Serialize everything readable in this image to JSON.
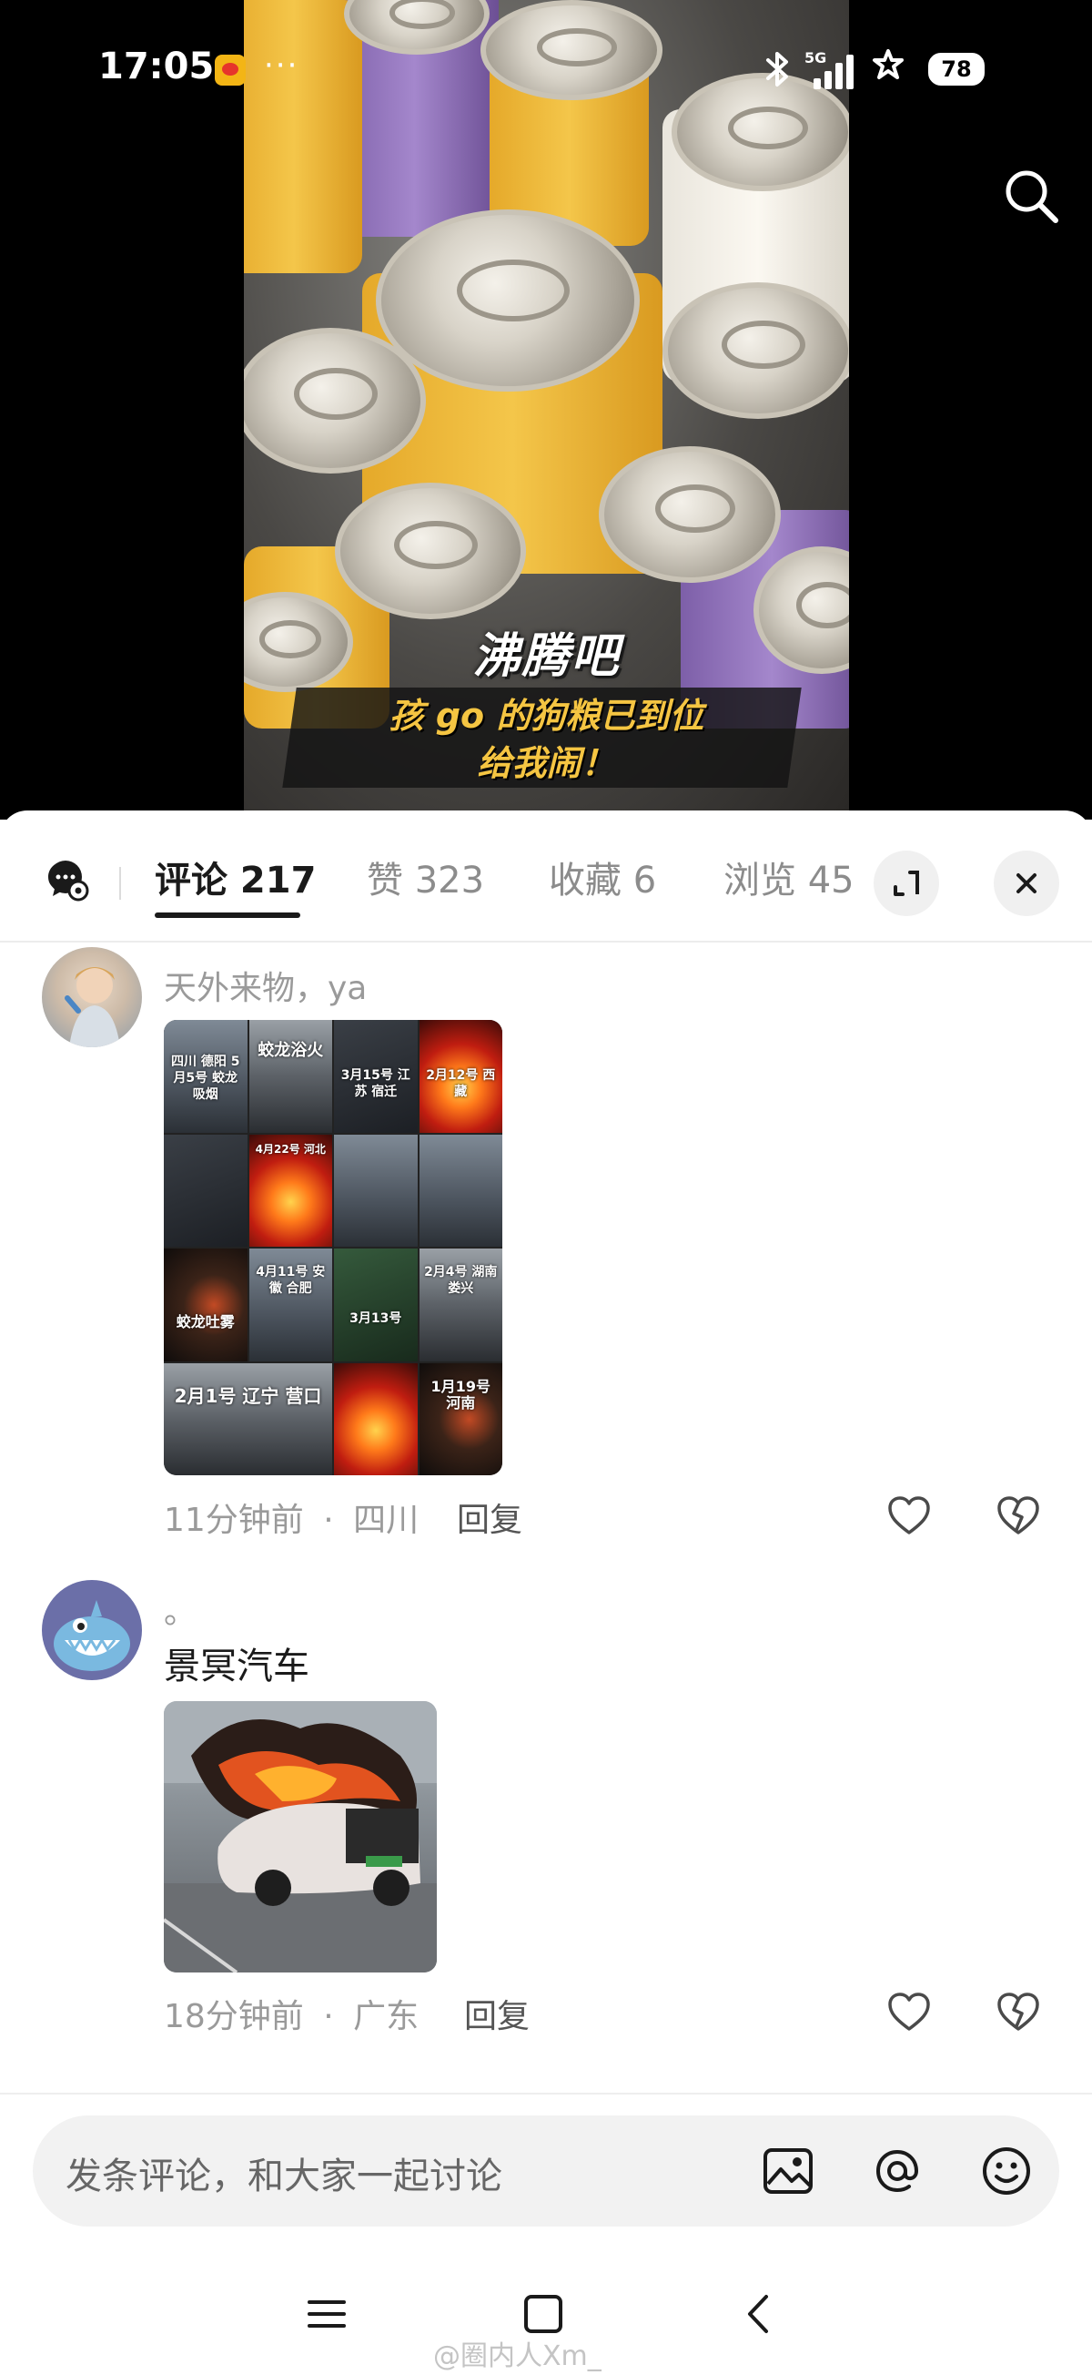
{
  "status_bar": {
    "time": "17:05",
    "dots": "···",
    "network": "5G",
    "battery": "78",
    "icons": [
      "weibo-notification-icon",
      "bluetooth-icon",
      "signal-icon",
      "star-icon",
      "battery-icon"
    ]
  },
  "video": {
    "caption_top": "沸腾吧",
    "caption_line1": "孩 go 的狗粮已到位",
    "caption_line2": "给我闹！"
  },
  "tabs": [
    {
      "label": "评论 217",
      "active": true
    },
    {
      "label": "赞 323",
      "active": false
    },
    {
      "label": "收藏 6",
      "active": false
    },
    {
      "label": "浏览 45",
      "active": false
    }
  ],
  "comments": [
    {
      "name": "天外来物，ya",
      "time": "11分钟前",
      "sep": "·",
      "location": "四川",
      "reply": "回复",
      "collage_labels": [
        "四川 德阳 5月5号 蛟龙吸烟",
        "蛟龙浴火",
        "4月22号 河北",
        "3月15号 江苏 宿迁",
        "2月12号 西藏",
        "蛟龙吐雾",
        "4月11号 安徽 合肥",
        "3月13号",
        "2月4号 湖南娄兴",
        "2月1号 辽宁 营口",
        "1月19号 河南"
      ]
    },
    {
      "name": "。",
      "text": "景冥汽车",
      "time": "18分钟前",
      "sep": "·",
      "location": "广东",
      "reply": "回复"
    }
  ],
  "input": {
    "placeholder": "发条评论，和大家一起讨论"
  },
  "watermark": "@圈内人Xm_",
  "colors": {
    "accent_text": "#1a1a1a",
    "muted_text": "#9a9a9a",
    "caption_yellow": "#f5c542",
    "sheet_bg": "#ffffff"
  }
}
